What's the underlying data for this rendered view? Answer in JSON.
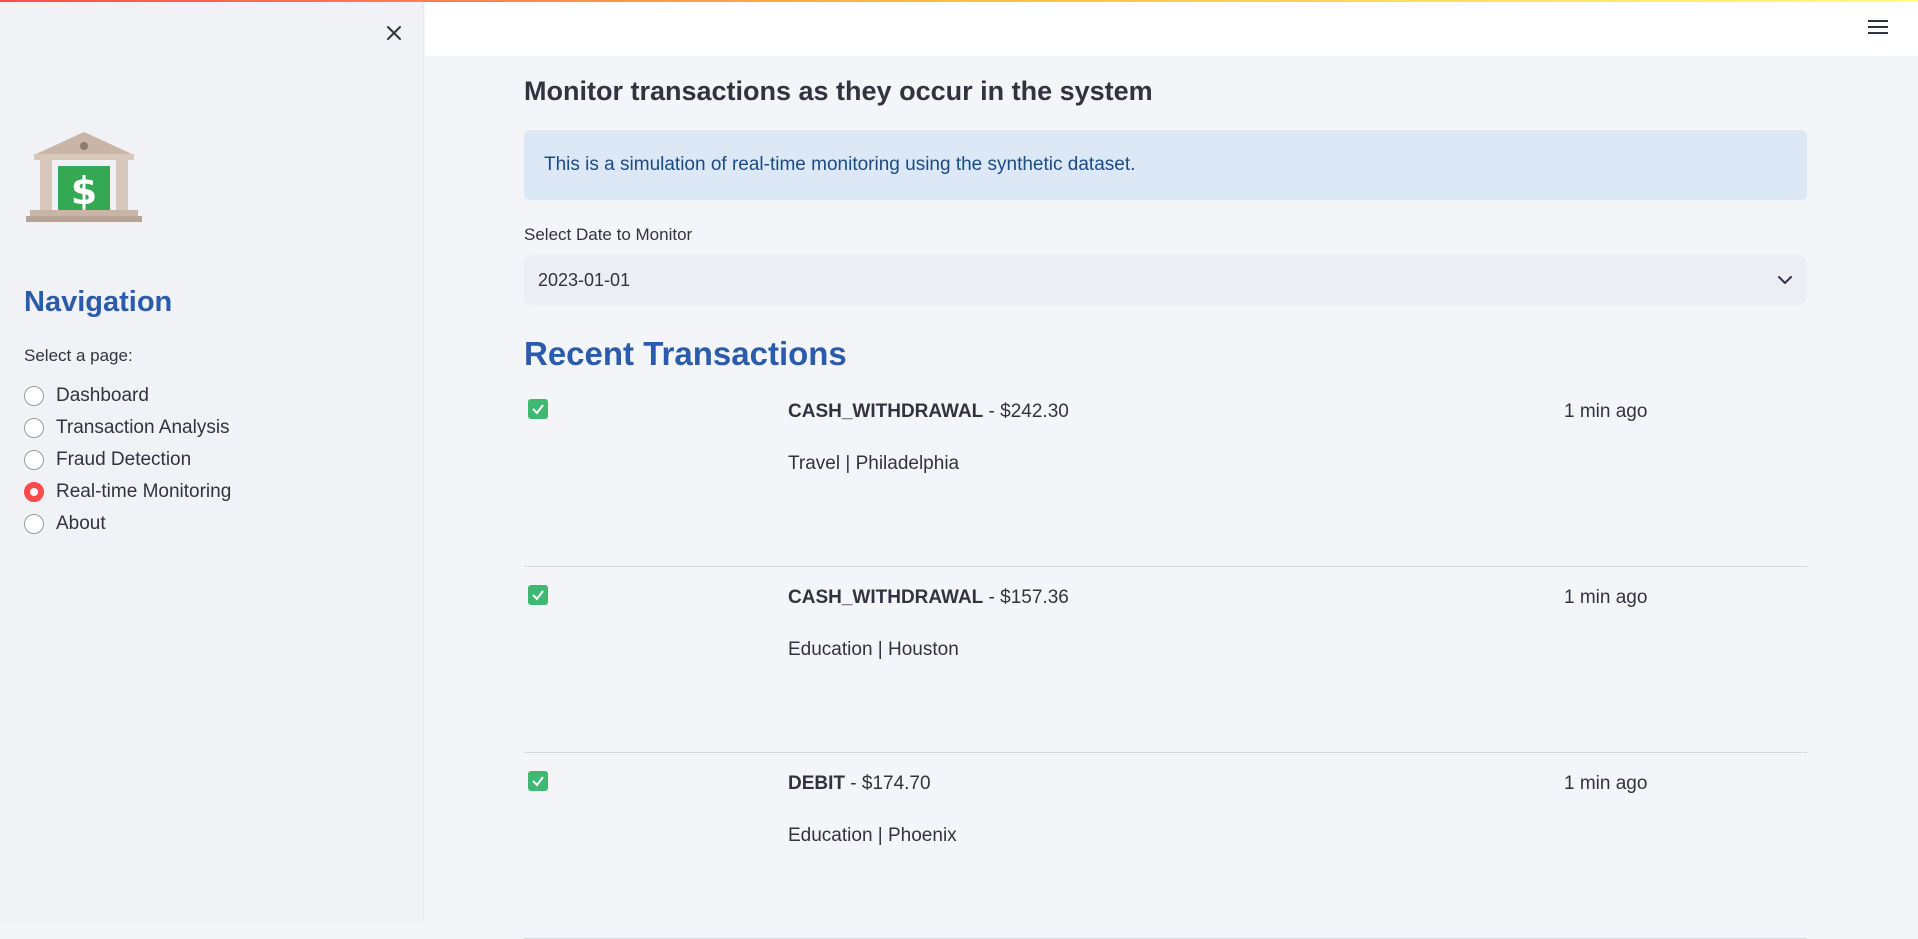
{
  "header": {
    "menu_icon": "hamburger-menu-icon"
  },
  "sidebar": {
    "close_icon": "close-icon",
    "logo_icon": "bank-dollar-icon",
    "nav_title": "Navigation",
    "prompt": "Select a page:",
    "options": [
      {
        "label": "Dashboard",
        "selected": false
      },
      {
        "label": "Transaction Analysis",
        "selected": false
      },
      {
        "label": "Fraud Detection",
        "selected": false
      },
      {
        "label": "Real-time Monitoring",
        "selected": true
      },
      {
        "label": "About",
        "selected": false
      }
    ]
  },
  "main": {
    "subtitle": "Monitor transactions as they occur in the system",
    "info": "This is a simulation of real-time monitoring using the synthetic dataset.",
    "date_label": "Select Date to Monitor",
    "date_value": "2023-01-01",
    "section_title": "Recent Transactions",
    "transactions": [
      {
        "type": "CASH_WITHDRAWAL",
        "amount": " - $242.30",
        "meta": "Travel | Philadelphia",
        "time": "1 min ago",
        "status_icon": "check-icon"
      },
      {
        "type": "CASH_WITHDRAWAL",
        "amount": " - $157.36",
        "meta": "Education | Houston",
        "time": "1 min ago",
        "status_icon": "check-icon"
      },
      {
        "type": "DEBIT",
        "amount": " - $174.70",
        "meta": "Education | Phoenix",
        "time": "1 min ago",
        "status_icon": "check-icon"
      }
    ]
  },
  "colors": {
    "accent": "#ff4b4b",
    "nav_title": "#2a5cab",
    "info_bg": "#dce8f6",
    "check_green": "#3fb871"
  }
}
